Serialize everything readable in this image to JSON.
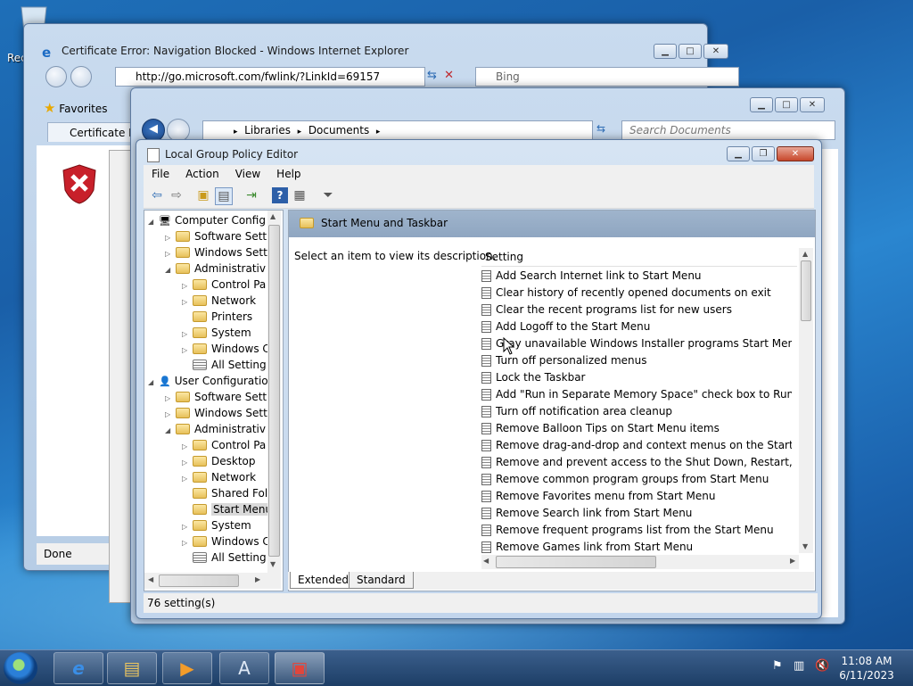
{
  "desktop": {
    "recycle_label": "Rec"
  },
  "ie": {
    "title": "Certificate Error: Navigation Blocked - Windows Internet Explorer",
    "url": "http://go.microsoft.com/fwlink/?LinkId=69157",
    "search_placeholder": "Bing",
    "favorites_label": "Favorites",
    "tab_label": "Certificate Err",
    "status": "Done"
  },
  "explorer": {
    "breadcrumb": [
      "Libraries",
      "Documents"
    ],
    "search_placeholder": "Search Documents"
  },
  "gpe": {
    "title": "Local Group Policy Editor",
    "menu": [
      "File",
      "Action",
      "View",
      "Help"
    ],
    "tree": [
      {
        "label": "Computer Config",
        "indent": 0,
        "expand": "open",
        "icon": "computer"
      },
      {
        "label": "Software Setti",
        "indent": 1,
        "expand": "closed",
        "icon": "folder"
      },
      {
        "label": "Windows Sett",
        "indent": 1,
        "expand": "closed",
        "icon": "folder"
      },
      {
        "label": "Administrativ",
        "indent": 1,
        "expand": "open",
        "icon": "folder"
      },
      {
        "label": "Control Pa",
        "indent": 2,
        "expand": "closed",
        "icon": "folder"
      },
      {
        "label": "Network",
        "indent": 2,
        "expand": "closed",
        "icon": "folder"
      },
      {
        "label": "Printers",
        "indent": 2,
        "expand": "none",
        "icon": "folder"
      },
      {
        "label": "System",
        "indent": 2,
        "expand": "closed",
        "icon": "folder"
      },
      {
        "label": "Windows C",
        "indent": 2,
        "expand": "closed",
        "icon": "folder"
      },
      {
        "label": "All Setting",
        "indent": 2,
        "expand": "none",
        "icon": "settings"
      },
      {
        "label": "User Configuratio",
        "indent": 0,
        "expand": "open",
        "icon": "user"
      },
      {
        "label": "Software Setti",
        "indent": 1,
        "expand": "closed",
        "icon": "folder"
      },
      {
        "label": "Windows Sett",
        "indent": 1,
        "expand": "closed",
        "icon": "folder"
      },
      {
        "label": "Administrativ",
        "indent": 1,
        "expand": "open",
        "icon": "folder"
      },
      {
        "label": "Control Pa",
        "indent": 2,
        "expand": "closed",
        "icon": "folder"
      },
      {
        "label": "Desktop",
        "indent": 2,
        "expand": "closed",
        "icon": "folder"
      },
      {
        "label": "Network",
        "indent": 2,
        "expand": "closed",
        "icon": "folder"
      },
      {
        "label": "Shared Fol",
        "indent": 2,
        "expand": "none",
        "icon": "folder"
      },
      {
        "label": "Start Menu",
        "indent": 2,
        "expand": "none",
        "icon": "folder",
        "selected": true
      },
      {
        "label": "System",
        "indent": 2,
        "expand": "closed",
        "icon": "folder"
      },
      {
        "label": "Windows C",
        "indent": 2,
        "expand": "closed",
        "icon": "folder"
      },
      {
        "label": "All Setting",
        "indent": 2,
        "expand": "none",
        "icon": "settings"
      }
    ],
    "section_title": "Start Menu and Taskbar",
    "description": "Select an item to view its description.",
    "column_header": "Setting",
    "settings": [
      "Add Search Internet link to Start Menu",
      "Clear history of recently opened documents on exit",
      "Clear the recent programs list for new users",
      "Add Logoff to the Start Menu",
      "Gray unavailable Windows Installer programs Start Menu sh...",
      "Turn off personalized menus",
      "Lock the Taskbar",
      "Add \"Run in Separate Memory Space\" check box to Run dial...",
      "Turn off notification area cleanup",
      "Remove Balloon Tips on Start Menu items",
      "Remove drag-and-drop and context menus on the Start Me...",
      "Remove and prevent access to the Shut Down, Restart, Sleep...",
      "Remove common program groups from Start Menu",
      "Remove Favorites menu from Start Menu",
      "Remove Search link from Start Menu",
      "Remove frequent programs list from the Start Menu",
      "Remove Games link from Start Menu"
    ],
    "tabs": [
      "Extended",
      "Standard"
    ],
    "status": "76 setting(s)"
  },
  "taskbar": {
    "time": "11:08 AM",
    "date": "6/11/2023"
  }
}
